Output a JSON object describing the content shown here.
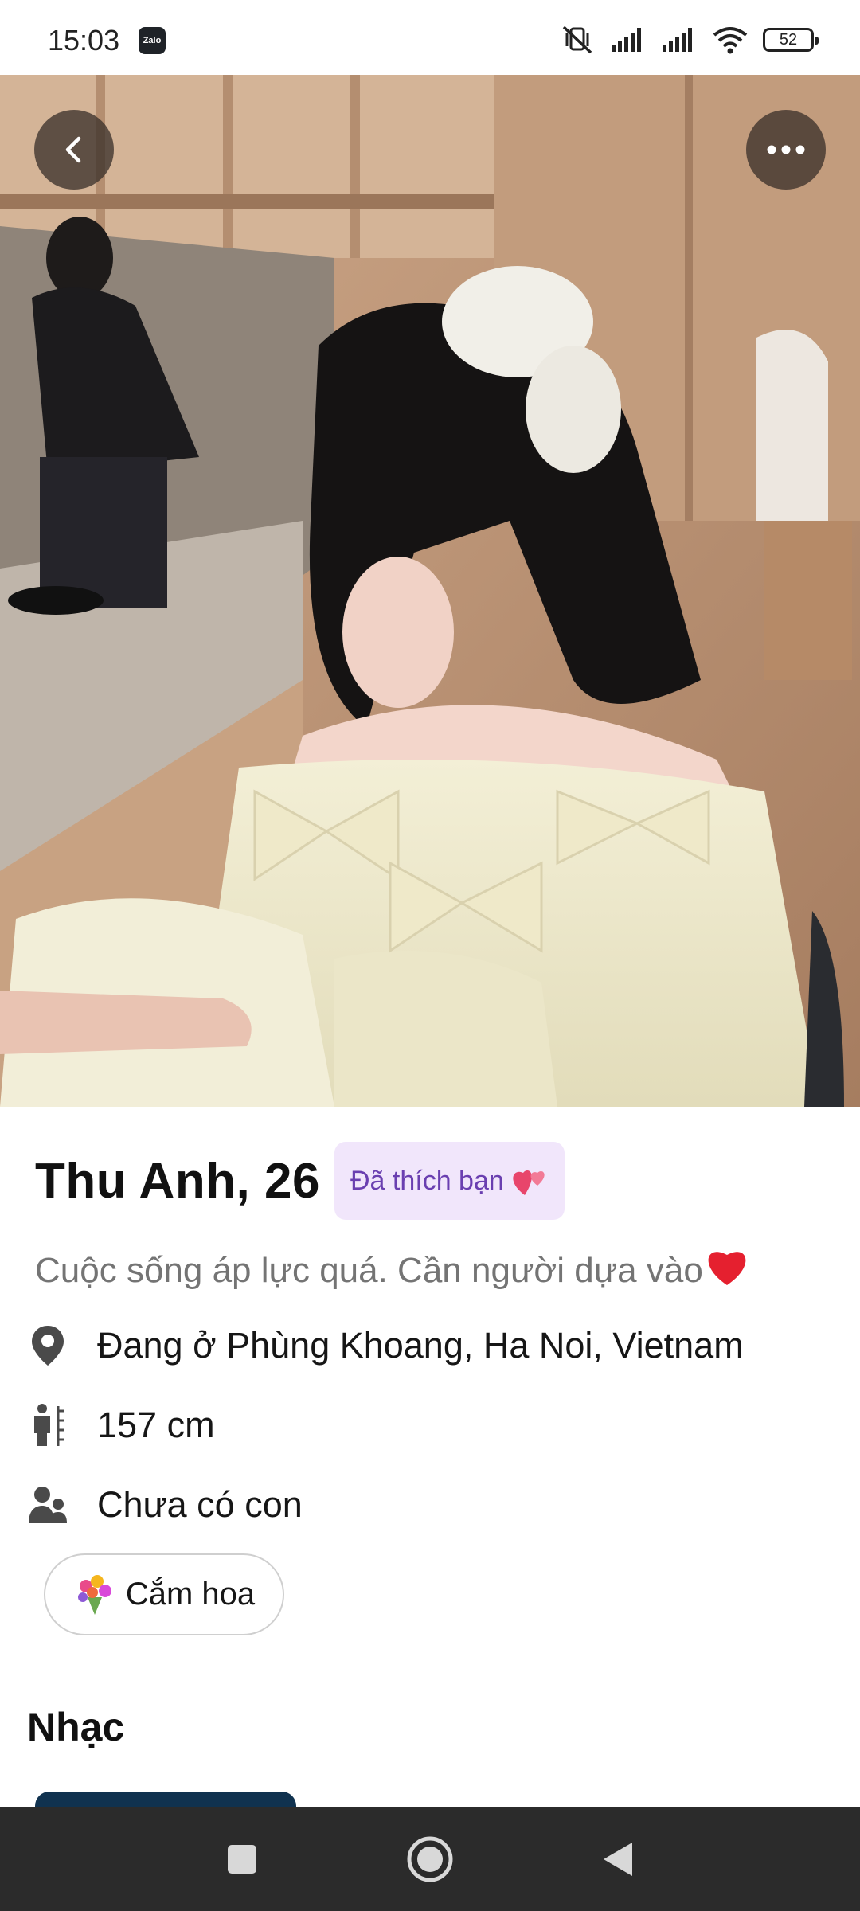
{
  "status_bar": {
    "time": "15:03",
    "notification_app": "Zalo",
    "battery": "52",
    "icons": [
      "zalo-icon",
      "mute-icon",
      "signal-icon",
      "signal-icon",
      "wifi-icon",
      "battery-icon"
    ]
  },
  "photo": {
    "alt": "Profile photo",
    "back_icon": "chevron-left-icon",
    "more_icon": "more-horizontal-icon"
  },
  "profile": {
    "name_age": "Thu Anh, 26",
    "liked_badge": "Đã thích bạn",
    "liked_badge_icon": "two-hearts-icon",
    "bio": "Cuộc sống áp lực quá. Cần người dựa vào",
    "bio_icon": "red-heart-icon",
    "location": "Đang ở Phùng Khoang, Ha Noi, Vietnam",
    "height": "157 cm",
    "children": "Chưa có con",
    "interest": "Cắm hoa",
    "interest_icon": "bouquet-icon"
  },
  "sections": {
    "music_title": "Nhạc"
  },
  "nav_bar": {
    "icons": [
      "recents-square-icon",
      "home-circle-icon",
      "back-triangle-icon"
    ]
  },
  "colors": {
    "badge_bg": "#f1e6fb",
    "badge_text": "#6a3fb0",
    "bio_text": "#747474",
    "nav_bg": "#2b2b2b"
  }
}
